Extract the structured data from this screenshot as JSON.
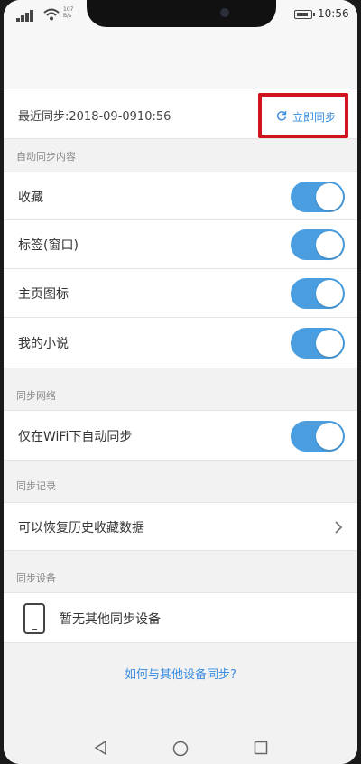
{
  "status_bar": {
    "speed_top": "107",
    "speed_bottom": "B/s",
    "time": "10:56"
  },
  "sync_header": {
    "last_sync": "最近同步:2018-09-0910:56",
    "sync_now_label": "立即同步"
  },
  "sections": {
    "auto_sync_content": "自动同步内容",
    "sync_network": "同步网络",
    "sync_records": "同步记录",
    "sync_devices": "同步设备"
  },
  "auto_sync_items": [
    {
      "label": "收藏",
      "enabled": true
    },
    {
      "label": "标签(窗口)",
      "enabled": true
    },
    {
      "label": "主页图标",
      "enabled": true
    },
    {
      "label": "我的小说",
      "enabled": true
    }
  ],
  "network": {
    "wifi_only_label": "仅在WiFi下自动同步",
    "wifi_only_enabled": true
  },
  "records": {
    "restore_label": "可以恢复历史收藏数据"
  },
  "devices": {
    "no_device_label": "暂无其他同步设备"
  },
  "help_link": "如何与其他设备同步?",
  "colors": {
    "accent": "#4a9ee0",
    "link": "#3a8dde",
    "highlight_border": "#d0141d"
  }
}
